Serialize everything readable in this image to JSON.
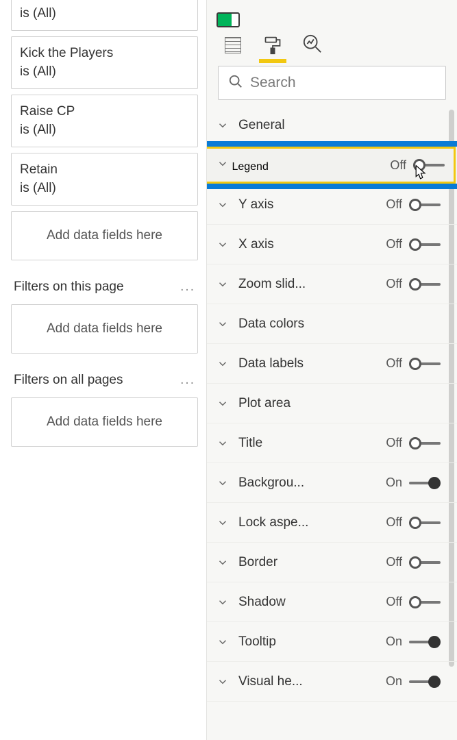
{
  "filters": {
    "visual_filters": [
      {
        "name": "",
        "sub": "is (All)"
      },
      {
        "name": "Kick the Players",
        "sub": "is (All)"
      },
      {
        "name": "Raise CP",
        "sub": "is (All)"
      },
      {
        "name": "Retain",
        "sub": "is (All)"
      }
    ],
    "add_placeholder": "Add data fields here",
    "page_heading": "Filters on this page",
    "all_heading": "Filters on all pages",
    "ellipsis": "..."
  },
  "format_panel": {
    "search_placeholder": "Search",
    "rows": [
      {
        "label": "General",
        "toggle": null
      },
      {
        "label": "Legend",
        "toggle": "Off",
        "highlighted": true
      },
      {
        "label": "Y axis",
        "toggle": "Off"
      },
      {
        "label": "X axis",
        "toggle": "Off"
      },
      {
        "label": "Zoom slid...",
        "toggle": "Off"
      },
      {
        "label": "Data colors",
        "toggle": null
      },
      {
        "label": "Data labels",
        "toggle": "Off"
      },
      {
        "label": "Plot area",
        "toggle": null
      },
      {
        "label": "Title",
        "toggle": "Off"
      },
      {
        "label": "Backgrou...",
        "toggle": "On"
      },
      {
        "label": "Lock aspe...",
        "toggle": "Off"
      },
      {
        "label": "Border",
        "toggle": "Off"
      },
      {
        "label": "Shadow",
        "toggle": "Off"
      },
      {
        "label": "Tooltip",
        "toggle": "On"
      },
      {
        "label": "Visual he...",
        "toggle": "On"
      }
    ]
  },
  "icons": {
    "search": "search-icon",
    "chevron": "chevron-down-icon"
  }
}
